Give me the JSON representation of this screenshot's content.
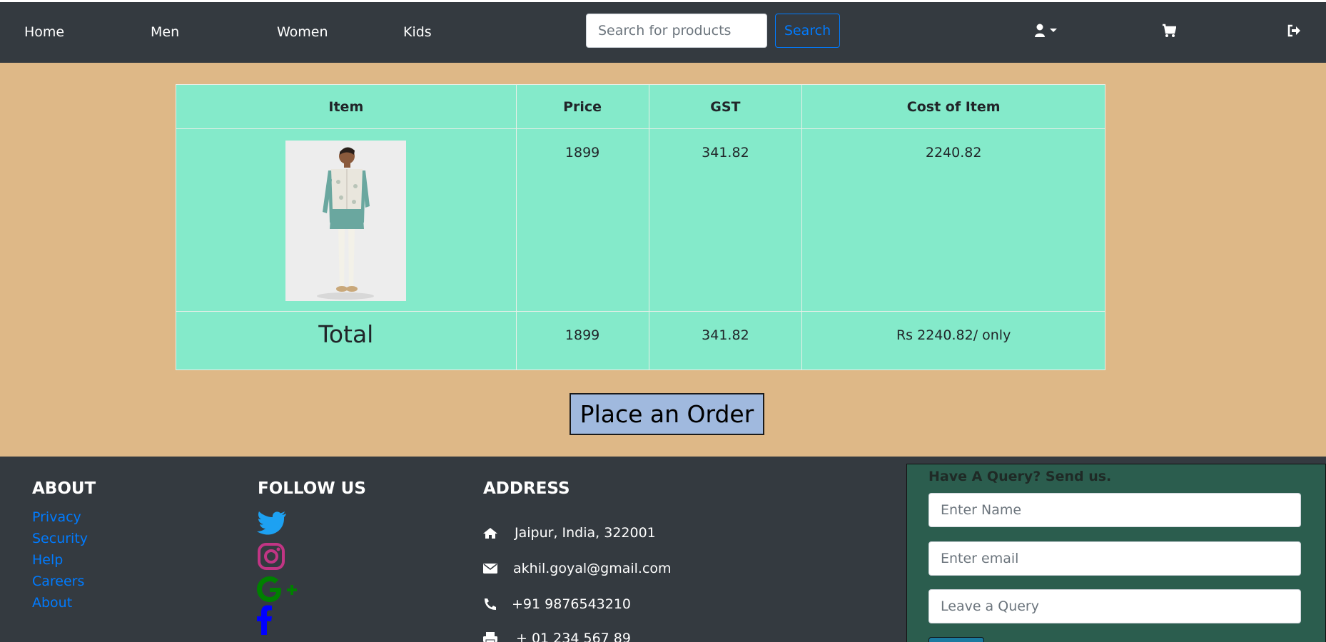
{
  "nav": {
    "links": [
      "Home",
      "Men",
      "Women",
      "Kids"
    ],
    "search_placeholder": "Search for products",
    "search_button": "Search",
    "icons": [
      "user-icon",
      "cart-icon",
      "sign-out-icon"
    ]
  },
  "cart": {
    "headers": [
      "Item",
      "Price",
      "GST",
      "Cost of Item"
    ],
    "items": [
      {
        "image": "man-kurta-jacket-photo",
        "price": "1899",
        "gst": "341.82",
        "cost": "2240.82"
      }
    ],
    "total": {
      "label": "Total",
      "price": "1899",
      "gst": "341.82",
      "cost": "Rs 2240.82/ only"
    },
    "order_button": "Place an Order"
  },
  "footer": {
    "about": {
      "heading": "ABOUT",
      "links": [
        "Privacy",
        "Security",
        "Help",
        "Careers",
        "About"
      ]
    },
    "follow": {
      "heading": "FOLLOW US",
      "icons": [
        "twitter-icon",
        "instagram-icon",
        "google-plus-icon",
        "facebook-icon"
      ]
    },
    "address": {
      "heading": "ADDRESS",
      "rows": [
        {
          "icon": "home-icon",
          "text": "Jaipur, India, 322001"
        },
        {
          "icon": "envelope-icon",
          "text": "akhil.goyal@gmail.com"
        },
        {
          "icon": "phone-icon",
          "text": "+91 9876543210"
        },
        {
          "icon": "print-icon",
          "text": "+ 01 234 567 89"
        }
      ]
    },
    "query": {
      "title": "Have A Query? Send us.",
      "name_placeholder": "Enter Name",
      "email_placeholder": "Enter email",
      "query_placeholder": "Leave a Query"
    }
  },
  "colors": {
    "navbar": "#343a40",
    "page_bg": "#deb887",
    "table_bg": "#84eaca",
    "link": "#007bff",
    "query_bg": "#2b5d4e",
    "order_button": "#a0b9de"
  }
}
